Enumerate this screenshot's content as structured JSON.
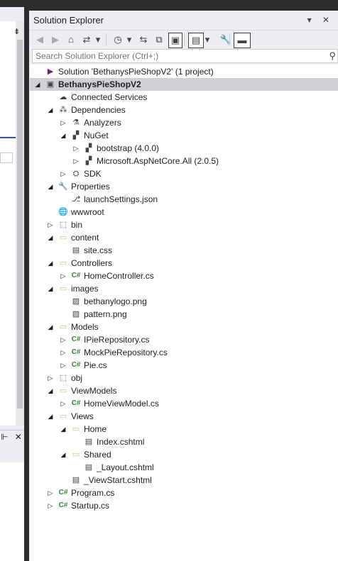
{
  "panel": {
    "title": "Solution Explorer",
    "search_placeholder": "Search Solution Explorer (Ctrl+;)",
    "title_buttons": "▾ ✕"
  },
  "left_panel": {
    "pin_glyph": "⇟",
    "bottom_glyphs": "⊩ ✕"
  },
  "toolbar": [
    {
      "name": "back-button",
      "icon": "◀",
      "dim": true
    },
    {
      "name": "forward-button",
      "icon": "▶",
      "dim": true
    },
    {
      "name": "home-button",
      "icon": "⌂"
    },
    {
      "name": "switch-views-button",
      "icon": "⇄"
    },
    {
      "name": "switch-views-dropdown",
      "icon": "▾"
    },
    {
      "name": "pending-changes-button",
      "icon": "◷"
    },
    {
      "name": "pending-changes-dropdown",
      "icon": "▾"
    },
    {
      "name": "sync-button",
      "icon": "⇆"
    },
    {
      "name": "collapse-all-button",
      "icon": "⧉"
    },
    {
      "name": "show-all-files-button",
      "icon": "▣",
      "boxed": true
    },
    {
      "name": "preview-button",
      "icon": "▤",
      "boxed": true
    },
    {
      "name": "preview-dropdown",
      "icon": "▾"
    },
    {
      "name": "properties-button",
      "icon": "🔧"
    },
    {
      "name": "pin-button",
      "icon": "▬",
      "boxed": true
    }
  ],
  "tree": [
    {
      "label": "Solution 'BethanysPieShopV2' (1 project)",
      "icon": "vs",
      "glyph": "▶",
      "indent": 0,
      "exp": ""
    },
    {
      "label": "BethanysPieShopV2",
      "icon": "project",
      "glyph": "▣",
      "indent": 0,
      "exp": "◢",
      "bold": true,
      "selected": true
    },
    {
      "label": "Connected Services",
      "icon": "gray",
      "glyph": "☁",
      "indent": 1,
      "exp": ""
    },
    {
      "label": "Dependencies",
      "icon": "gray",
      "glyph": "⁂",
      "indent": 1,
      "exp": "◢"
    },
    {
      "label": "Analyzers",
      "icon": "gray",
      "glyph": "⚗",
      "indent": 2,
      "exp": "▷"
    },
    {
      "label": "NuGet",
      "icon": "gray",
      "glyph": "▞",
      "indent": 2,
      "exp": "◢"
    },
    {
      "label": "bootstrap (4.0.0)",
      "icon": "gray",
      "glyph": "▞",
      "indent": 3,
      "exp": "▷"
    },
    {
      "label": "Microsoft.AspNetCore.All (2.0.5)",
      "icon": "gray",
      "glyph": "▞",
      "indent": 3,
      "exp": "▷"
    },
    {
      "label": "SDK",
      "icon": "gray",
      "glyph": "⛭",
      "indent": 2,
      "exp": "▷"
    },
    {
      "label": "Properties",
      "icon": "gray",
      "glyph": "🔧",
      "indent": 1,
      "exp": "◢"
    },
    {
      "label": "launchSettings.json",
      "icon": "gray",
      "glyph": "⎇",
      "indent": 2,
      "exp": ""
    },
    {
      "label": "wwwroot",
      "icon": "gray",
      "glyph": "🌐",
      "indent": 1,
      "exp": ""
    },
    {
      "label": "bin",
      "icon": "gray",
      "glyph": "⬚",
      "indent": 1,
      "exp": "▷"
    },
    {
      "label": "content",
      "icon": "folder",
      "glyph": "▭",
      "indent": 1,
      "exp": "◢"
    },
    {
      "label": "site.css",
      "icon": "gray",
      "glyph": "▤",
      "indent": 2,
      "exp": ""
    },
    {
      "label": "Controllers",
      "icon": "folder",
      "glyph": "▭",
      "indent": 1,
      "exp": "◢"
    },
    {
      "label": "HomeController.cs",
      "icon": "cs",
      "glyph": "C#",
      "indent": 2,
      "exp": "▷"
    },
    {
      "label": "images",
      "icon": "folder",
      "glyph": "▭",
      "indent": 1,
      "exp": "◢"
    },
    {
      "label": "bethanylogo.png",
      "icon": "gray",
      "glyph": "▨",
      "indent": 2,
      "exp": ""
    },
    {
      "label": "pattern.png",
      "icon": "gray",
      "glyph": "▨",
      "indent": 2,
      "exp": ""
    },
    {
      "label": "Models",
      "icon": "folder",
      "glyph": "▭",
      "indent": 1,
      "exp": "◢"
    },
    {
      "label": "IPieRepository.cs",
      "icon": "cs",
      "glyph": "C#",
      "indent": 2,
      "exp": "▷"
    },
    {
      "label": "MockPieRepository.cs",
      "icon": "cs",
      "glyph": "C#",
      "indent": 2,
      "exp": "▷"
    },
    {
      "label": "Pie.cs",
      "icon": "cs",
      "glyph": "C#",
      "indent": 2,
      "exp": "▷"
    },
    {
      "label": "obj",
      "icon": "gray",
      "glyph": "⬚",
      "indent": 1,
      "exp": "▷"
    },
    {
      "label": "ViewModels",
      "icon": "folder",
      "glyph": "▭",
      "indent": 1,
      "exp": "◢"
    },
    {
      "label": "HomeViewModel.cs",
      "icon": "cs",
      "glyph": "C#",
      "indent": 2,
      "exp": "▷"
    },
    {
      "label": "Views",
      "icon": "folder",
      "glyph": "▭",
      "indent": 1,
      "exp": "◢"
    },
    {
      "label": "Home",
      "icon": "folder",
      "glyph": "▭",
      "indent": 2,
      "exp": "◢"
    },
    {
      "label": "Index.cshtml",
      "icon": "gray",
      "glyph": "▤",
      "indent": 3,
      "exp": ""
    },
    {
      "label": "Shared",
      "icon": "folder",
      "glyph": "▭",
      "indent": 2,
      "exp": "◢"
    },
    {
      "label": "_Layout.cshtml",
      "icon": "gray",
      "glyph": "▤",
      "indent": 3,
      "exp": ""
    },
    {
      "label": "_ViewStart.cshtml",
      "icon": "gray",
      "glyph": "▤",
      "indent": 2,
      "exp": ""
    },
    {
      "label": "Program.cs",
      "icon": "cs",
      "glyph": "C#",
      "indent": 1,
      "exp": "▷"
    },
    {
      "label": "Startup.cs",
      "icon": "cs",
      "glyph": "C#",
      "indent": 1,
      "exp": "▷"
    }
  ]
}
